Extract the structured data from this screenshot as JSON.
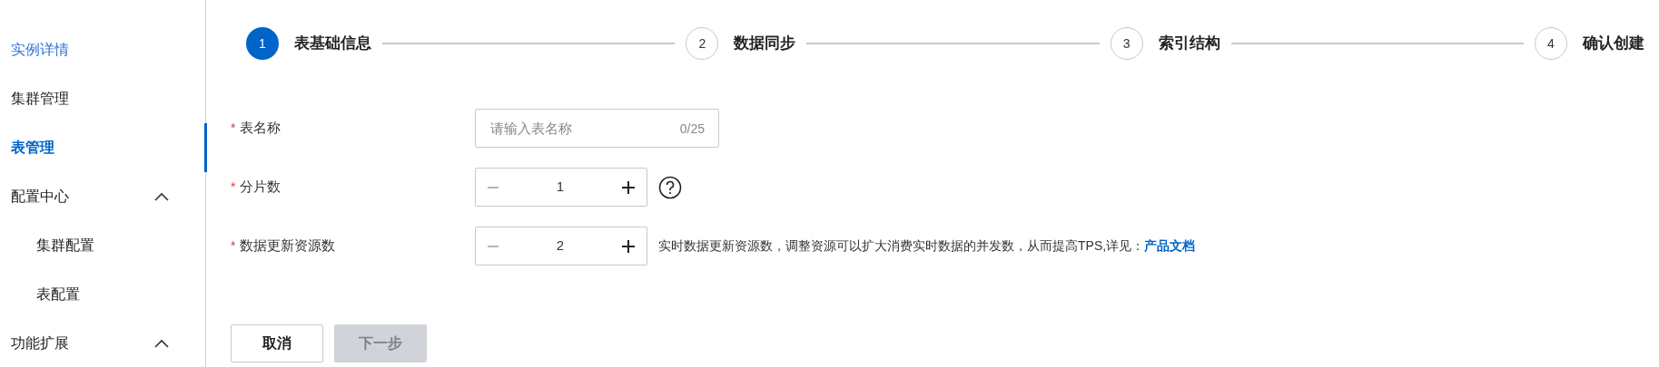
{
  "sidebar": {
    "items": [
      {
        "label": "实例详情",
        "selected": false,
        "kind": "link"
      },
      {
        "label": "集群管理",
        "selected": false,
        "kind": "plain"
      },
      {
        "label": "表管理",
        "selected": true,
        "kind": "plain"
      },
      {
        "label": "配置中心",
        "selected": false,
        "kind": "group",
        "expanded": true,
        "children": [
          {
            "label": "集群配置",
            "selected": false
          },
          {
            "label": "表配置",
            "selected": false
          }
        ]
      },
      {
        "label": "功能扩展",
        "selected": false,
        "kind": "group",
        "expanded": true
      }
    ]
  },
  "steps": [
    {
      "number": "1",
      "label": "表基础信息",
      "selected": true
    },
    {
      "number": "2",
      "label": "数据同步",
      "selected": false
    },
    {
      "number": "3",
      "label": "索引结构",
      "selected": false
    },
    {
      "number": "4",
      "label": "确认创建",
      "selected": false
    }
  ],
  "form": {
    "fields": [
      {
        "kind": "text",
        "required_mark": "*",
        "label": "表名称",
        "placeholder": "请输入表名称",
        "counter": "0/25"
      },
      {
        "kind": "stepper",
        "required_mark": "*",
        "label": "分片数",
        "value": "1",
        "help": true
      },
      {
        "kind": "stepper",
        "required_mark": "*",
        "label": "数据更新资源数",
        "value": "2",
        "note": "实时数据更新资源数，调整资源可以扩大消费实时数据的并发数，从而提高TPS,详见：",
        "link": "产品文档"
      }
    ]
  },
  "buttons": [
    {
      "label": "取消",
      "disabled": false
    },
    {
      "label": "下一步",
      "disabled": true
    }
  ]
}
